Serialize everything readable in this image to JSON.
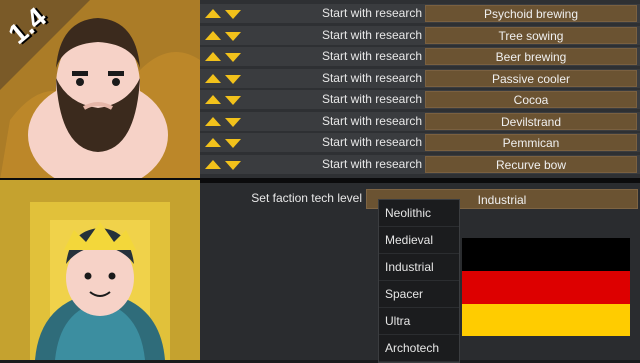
{
  "version_badge": "1.4",
  "research": {
    "row_label": "Start with research",
    "items": [
      "Psychoid brewing",
      "Tree sowing",
      "Beer brewing",
      "Passive cooler",
      "Cocoa",
      "Devilstrand",
      "Pemmican",
      "Recurve bow"
    ]
  },
  "faction": {
    "label": "Set faction tech level",
    "selected": "Industrial",
    "options": [
      "Neolithic",
      "Medieval",
      "Industrial",
      "Spacer",
      "Ultra",
      "Archotech"
    ]
  },
  "colors": {
    "button": "#6b5332",
    "arrow": "#f2c21b",
    "flag_black": "#000000",
    "flag_red": "#dd0000",
    "flag_gold": "#ffcc00"
  }
}
